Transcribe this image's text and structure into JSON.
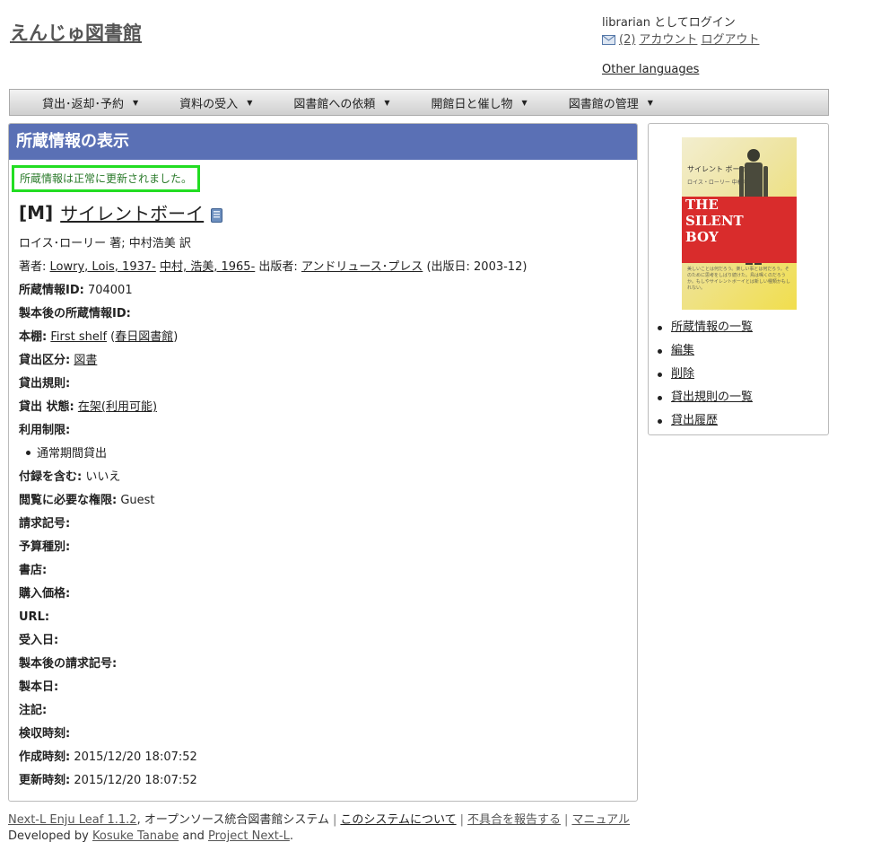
{
  "site": {
    "title": "えんじゅ図書館"
  },
  "user": {
    "login_text": "librarian としてログイン",
    "messages": "(2)",
    "account": "アカウント",
    "logout": "ログアウト",
    "other_languages": "Other languages"
  },
  "menu": [
    {
      "label": "貸出･返却･予約"
    },
    {
      "label": "資料の受入"
    },
    {
      "label": "図書館への依頼"
    },
    {
      "label": "開館日と催し物"
    },
    {
      "label": "図書館の管理"
    }
  ],
  "page": {
    "title": "所蔵情報の表示",
    "notice": "所蔵情報は正常に更新されました。",
    "item_type": "[M]",
    "item_title": "サイレントボーイ",
    "statement": "ロイス･ローリー 著; 中村浩美 訳"
  },
  "creators": {
    "label": "著者:",
    "author1": "Lowry, Lois, 1937-",
    "author2": "中村, 浩美, 1965-",
    "publisher_label": "出版者:",
    "publisher": "アンドリュース･プレス",
    "pubdate": "(出版日: 2003-12)"
  },
  "fields": {
    "item_id": {
      "label": "所蔵情報ID:",
      "value": "704001"
    },
    "binding_item_id": {
      "label": "製本後の所蔵情報ID:",
      "value": ""
    },
    "shelf": {
      "label": "本棚:",
      "value": "First shelf",
      "library": "春日図書館"
    },
    "checkout_type": {
      "label": "貸出区分:",
      "value": "図書"
    },
    "lending_rule": {
      "label": "貸出規則:",
      "value": ""
    },
    "circulation_status": {
      "label": "貸出 状態:",
      "value": "在架(利用可能)"
    },
    "use_restriction": {
      "label": "利用制限:",
      "value": "通常期間貸出"
    },
    "include_supplements": {
      "label": "付録を含む:",
      "value": "いいえ"
    },
    "required_role": {
      "label": "閲覧に必要な権限:",
      "value": "Guest"
    },
    "call_number": {
      "label": "請求記号:",
      "value": ""
    },
    "budget_type": {
      "label": "予算種別:",
      "value": ""
    },
    "bookstore": {
      "label": "書店:",
      "value": ""
    },
    "price": {
      "label": "購入価格:",
      "value": ""
    },
    "url": {
      "label": "URL:",
      "value": ""
    },
    "acquired_at": {
      "label": "受入日:",
      "value": ""
    },
    "binding_call_number": {
      "label": "製本後の請求記号:",
      "value": ""
    },
    "binded_at": {
      "label": "製本日:",
      "value": ""
    },
    "note": {
      "label": "注記:",
      "value": ""
    },
    "inspected_at": {
      "label": "検収時刻:",
      "value": ""
    },
    "created_at": {
      "label": "作成時刻:",
      "value": "2015/12/20 18:07:52"
    },
    "updated_at": {
      "label": "更新時刻:",
      "value": "2015/12/20 18:07:52"
    }
  },
  "cover": {
    "jp_title": "サイレント ボーイ",
    "author": "ロイス・ローリー  中村浩美 訳",
    "en_title_1": "THE",
    "en_title_2": "SILENT",
    "en_title_3": "BOY",
    "blurb": "美しいことは何だろう。楽しい事とは何だろう。そのために思考をしばり続けた。鳥は鳴くのだろうか。もしやサイレントボーイとは新しい種類かもしれない。"
  },
  "sidebar": {
    "links": [
      {
        "label": "所蔵情報の一覧"
      },
      {
        "label": "編集"
      },
      {
        "label": "削除"
      },
      {
        "label": "貸出規則の一覧"
      },
      {
        "label": "貸出履歴"
      }
    ]
  },
  "footer": {
    "product": "Next-L Enju Leaf 1.1.2",
    "tagline": ", オープンソース統合図書館システム",
    "about": "このシステムについて",
    "report": "不具合を報告する",
    "manual": "マニュアル",
    "developed_by": "Developed by",
    "developer": "Kosuke Tanabe",
    "and": "and",
    "project": "Project Next-L",
    "period": "."
  },
  "colors": {
    "title_bar": "#5a70b5",
    "notice_border": "#22dd22",
    "notice_text": "#2a7a2a"
  }
}
